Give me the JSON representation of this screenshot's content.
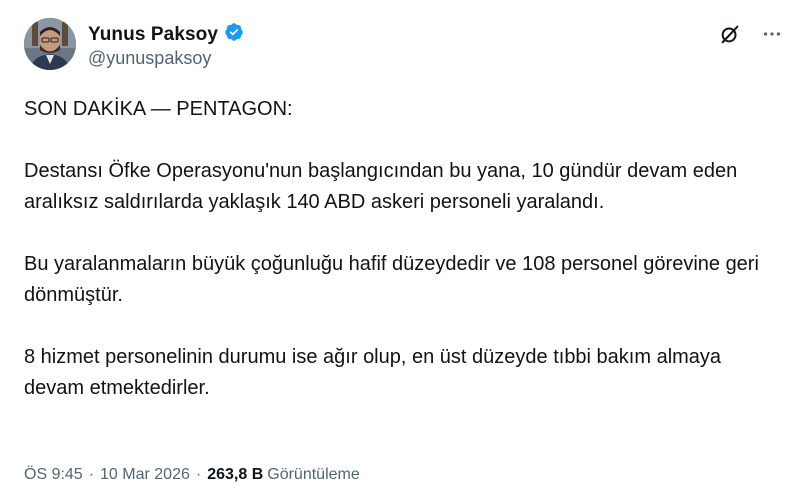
{
  "author": {
    "display_name": "Yunus Paksoy",
    "handle": "@yunuspaksoy",
    "verified_badge_color": "#1d9bf0"
  },
  "tweet": {
    "paragraphs": [
      "SON DAKİKA — PENTAGON:",
      "Destansı Öfke Operasyonu'nun başlangıcından bu yana, 10 gündür devam eden aralıksız saldırılarda yaklaşık 140 ABD askeri personeli yaralandı.",
      "Bu yaralanmaların büyük çoğunluğu hafif düzeydedir ve 108 personel görevine geri dönmüştür.",
      "8 hizmet personelinin durumu ise ağır olup, en üst düzeyde tıbbi bakım almaya devam etmektedirler."
    ]
  },
  "meta": {
    "time": "ÖS 9:45",
    "date": "10 Mar 2026",
    "views_count": "263,8 B",
    "views_label": "Görüntüleme",
    "separator": "·"
  },
  "icons": {
    "grok": "grok-icon",
    "more": "more-icon"
  }
}
